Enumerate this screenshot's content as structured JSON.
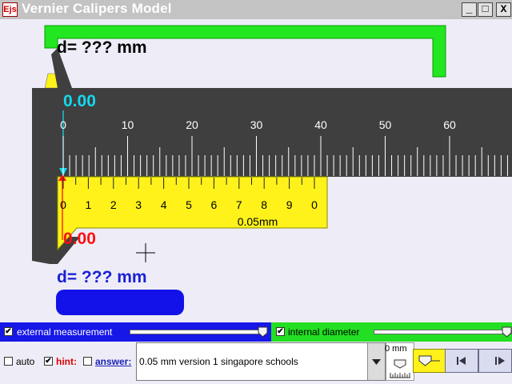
{
  "window": {
    "title": "Vernier Calipers Model",
    "icon_label": "Ejs",
    "minimize": "_",
    "maximize": "□",
    "close": "X"
  },
  "readouts": {
    "top_measurement": "d= ??? mm",
    "bottom_measurement": "d= ??? mm",
    "main_zero": "0.00",
    "vernier_zero": "0.00"
  },
  "main_scale": {
    "labels": [
      "0",
      "10",
      "20",
      "30",
      "40",
      "50",
      "60"
    ]
  },
  "vernier_scale": {
    "labels": [
      "0",
      "1",
      "2",
      "3",
      "4",
      "5",
      "6",
      "7",
      "8",
      "9",
      "0"
    ],
    "precision": "0.05mm"
  },
  "controls": {
    "external_label": "external measurement",
    "internal_label": "internal diameter",
    "auto_label": "auto",
    "hint_label": "hint:",
    "answer_label": "answer:",
    "dropdown_value": "0.05 mm version 1 singapore schools",
    "step_text": "0 mm"
  },
  "colors": {
    "jaw_green": "#22e61f",
    "vernier_yellow": "#fff21a",
    "body_dark": "#3f3f3f",
    "cyan": "#14d8ef",
    "red": "#ff1010",
    "blue": "#1717e8"
  },
  "icons": [
    "app-icon",
    "minimize-icon",
    "maximize-icon",
    "close-icon",
    "crosshair-icon",
    "chevron-down-icon",
    "slider-thumb-icon",
    "step-back-icon",
    "play-icon"
  ]
}
